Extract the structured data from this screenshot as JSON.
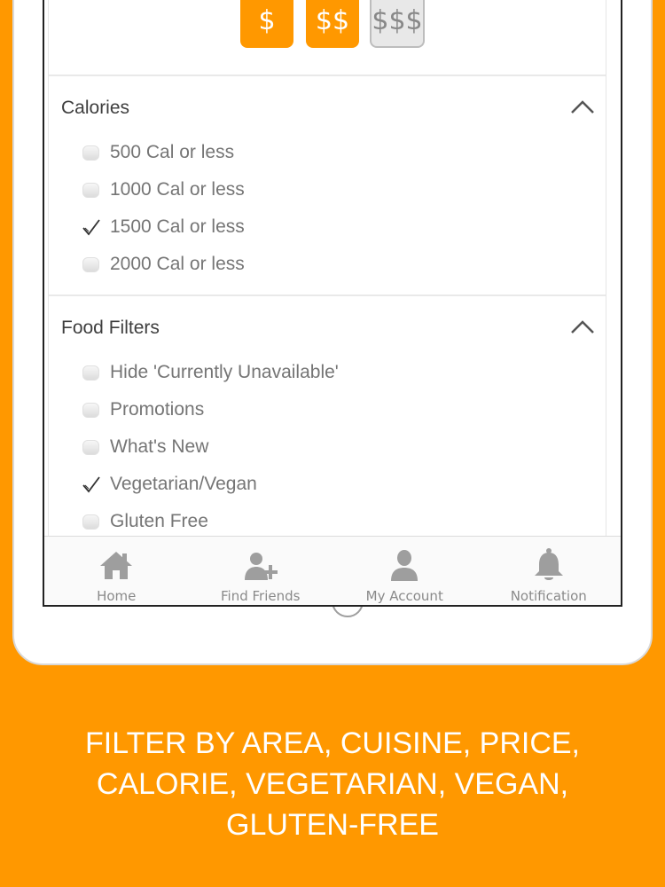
{
  "price": {
    "levels": [
      "$",
      "$$",
      "$$$"
    ]
  },
  "calories": {
    "title": "Calories",
    "options": [
      {
        "label": "500 Cal or less",
        "checked": false
      },
      {
        "label": "1000 Cal or less",
        "checked": false
      },
      {
        "label": "1500 Cal or less",
        "checked": true
      },
      {
        "label": "2000 Cal or less",
        "checked": false
      }
    ]
  },
  "food_filters": {
    "title": "Food Filters",
    "options": [
      {
        "label": "Hide 'Currently Unavailable'",
        "checked": false
      },
      {
        "label": "Promotions",
        "checked": false
      },
      {
        "label": "What's New",
        "checked": false
      },
      {
        "label": "Vegetarian/Vegan",
        "checked": true
      },
      {
        "label": "Gluten Free",
        "checked": false
      }
    ]
  },
  "tabbar": {
    "items": [
      {
        "label": "Home",
        "icon": "home-icon"
      },
      {
        "label": "Find Friends",
        "icon": "add-friend-icon"
      },
      {
        "label": "My Account",
        "icon": "user-icon"
      },
      {
        "label": "Notification",
        "icon": "bell-icon"
      }
    ]
  },
  "caption": {
    "lines": [
      "FILTER BY AREA, CUISINE, PRICE,",
      "CALORIE, VEGETARIAN, VEGAN,",
      "GLUTEN-FREE"
    ]
  },
  "colors": {
    "brand_orange": "#FF9800",
    "icon_gray": "#9e9e9e"
  }
}
